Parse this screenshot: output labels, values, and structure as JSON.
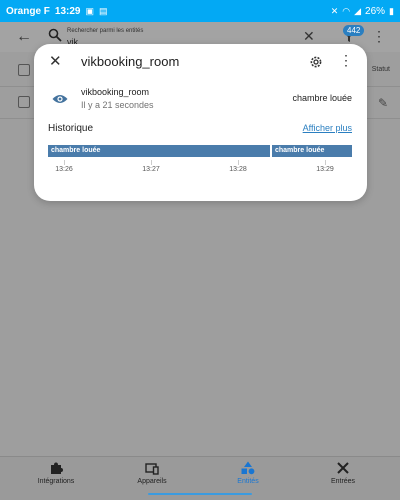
{
  "statusbar": {
    "carrier": "Orange F",
    "time": "13:29",
    "battery": "26%"
  },
  "toolbar": {
    "search_label": "Rechercher parmi les entités",
    "search_value": "vik",
    "badge_count": "442",
    "back_icon": "arrow-back-icon",
    "clear_icon": "close-icon",
    "filter_icon": "filter-icon",
    "more_icon": "more-vert-icon"
  },
  "table": {
    "statut_header": "Statut"
  },
  "dialog": {
    "title": "vikbooking_room",
    "entity_name": "vikbooking_room",
    "entity_time": "Il y a 21 secondes",
    "entity_state": "chambre louée",
    "history_title": "Historique",
    "history_more": "Afficher plus",
    "timeline": [
      {
        "label": "chambre louée"
      },
      {
        "label": "chambre louée"
      }
    ],
    "ticks": [
      "13:26",
      "13:27",
      "13:28",
      "13:29"
    ],
    "accent": "#4a7cab",
    "link_color": "#2a7fc1"
  },
  "bottomnav": {
    "items": [
      {
        "label": "Intégrations",
        "icon": "puzzle-icon",
        "active": false
      },
      {
        "label": "Appareils",
        "icon": "devices-icon",
        "active": false
      },
      {
        "label": "Entités",
        "icon": "shapes-icon",
        "active": true
      },
      {
        "label": "Entrées",
        "icon": "tools-icon",
        "active": false
      }
    ]
  }
}
